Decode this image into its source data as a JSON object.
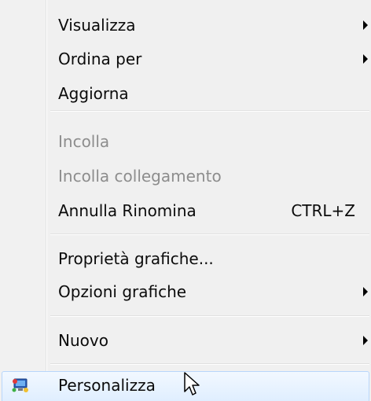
{
  "menu": {
    "items": [
      {
        "label": "Visualizza"
      },
      {
        "label": "Ordina per"
      },
      {
        "label": "Aggiorna"
      },
      {
        "label": "Incolla"
      },
      {
        "label": "Incolla collegamento"
      },
      {
        "label": "Annulla Rinomina",
        "shortcut": "CTRL+Z"
      },
      {
        "label": "Proprietà grafiche..."
      },
      {
        "label": "Opzioni grafiche"
      },
      {
        "label": "Nuovo"
      },
      {
        "label": "Personalizza",
        "icon": "personalize-icon"
      }
    ]
  },
  "colors": {
    "menu_background": "#f0f0f0",
    "disabled_text": "#8d8d8d",
    "highlight_border": "#b8d6fb",
    "highlight_fill": "#e8f2ff"
  },
  "icons": {
    "submenu": "chevron-right-icon",
    "cursor": "mouse-pointer-icon"
  }
}
